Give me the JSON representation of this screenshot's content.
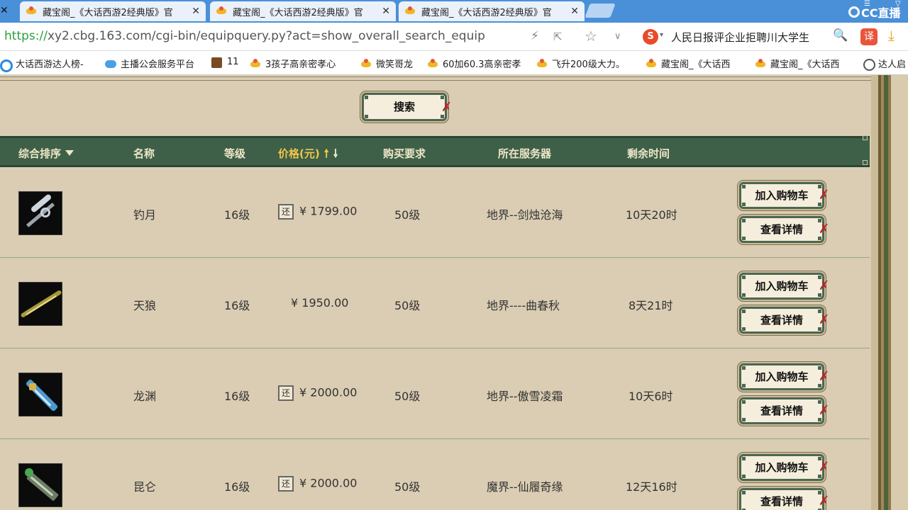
{
  "browser": {
    "tabs": [
      {
        "title": "藏宝阁_《大话西游2经典版》官"
      },
      {
        "title": "藏宝阁_《大话西游2经典版》官"
      },
      {
        "title": "藏宝阁_《大话西游2经典版》官"
      }
    ],
    "close_glyph": "✕",
    "brand": "CC直播",
    "url_scheme": "https://",
    "url_rest": "xy2.cbg.163.com/cgi-bin/equipquery.py?act=show_overall_search_equip",
    "news_ticker": "人民日报评企业拒聘川大学生",
    "sogou_label": "S",
    "translate_label": "译",
    "bookmarks": [
      {
        "label": "大话西游达人榜-",
        "icon": "cc-icon"
      },
      {
        "label": "主播公会服务平台",
        "icon": "cloud-icon"
      },
      {
        "label": "11",
        "icon": "game-icon"
      },
      {
        "label": "3孩子高亲密孝心",
        "icon": "duck-icon"
      },
      {
        "label": "微笑哥龙",
        "icon": "duck-icon"
      },
      {
        "label": "60加60.3高亲密孝",
        "icon": "duck-icon"
      },
      {
        "label": "飞升200级大力。",
        "icon": "duck-icon"
      },
      {
        "label": "藏宝阁_《大话西",
        "icon": "duck-icon"
      },
      {
        "label": "藏宝阁_《大话西",
        "icon": "duck-icon"
      },
      {
        "label": "达人启",
        "icon": "globe-icon"
      }
    ]
  },
  "search": {
    "button_label": "搜索"
  },
  "table": {
    "headers": {
      "sort": "综合排序",
      "name": "名称",
      "level": "等级",
      "price": "价格(元)",
      "requirement": "购买要求",
      "server": "所在服务器",
      "time_left": "剩余时间"
    },
    "rows": [
      {
        "name": "钓月",
        "level": "16级",
        "has_huan": true,
        "price": "¥ 1799.00",
        "requirement": "50级",
        "server": "地界--剑烛沧海",
        "time_left": "10天20时"
      },
      {
        "name": "天狼",
        "level": "16级",
        "has_huan": false,
        "price": "¥ 1950.00",
        "requirement": "50级",
        "server": "地界----曲春秋",
        "time_left": "8天21时"
      },
      {
        "name": "龙渊",
        "level": "16级",
        "has_huan": true,
        "price": "¥ 2000.00",
        "requirement": "50级",
        "server": "地界--傲雪凌霜",
        "time_left": "10天6时"
      },
      {
        "name": "昆仑",
        "level": "16级",
        "has_huan": true,
        "price": "¥ 2000.00",
        "requirement": "50级",
        "server": "魔界--仙履奇缘",
        "time_left": "12天16时"
      }
    ],
    "huan_label": "还",
    "add_to_cart_label": "加入购物车",
    "view_detail_label": "查看详情"
  },
  "colors": {
    "header_bg": "#3e6048",
    "header_text": "#efe6c8",
    "header_active": "#f2c64a",
    "page_bg": "#dacdb3",
    "knot": "#b8242a"
  }
}
